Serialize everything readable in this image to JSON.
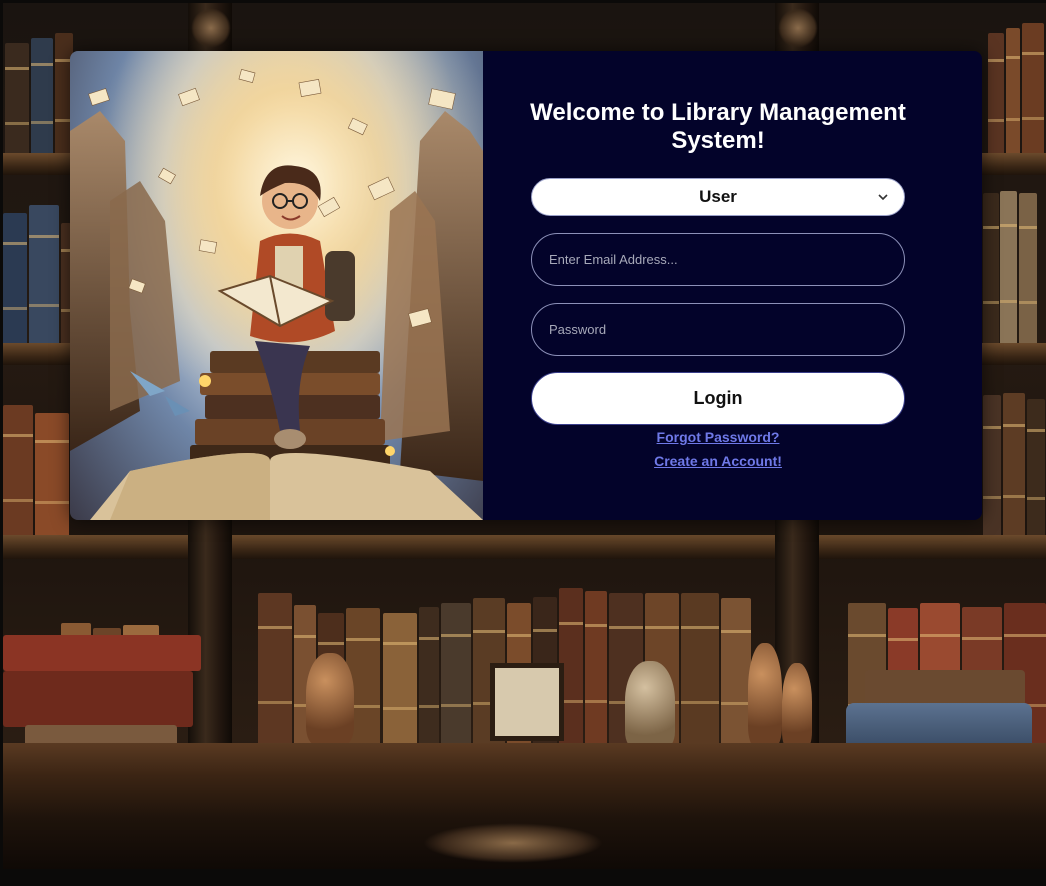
{
  "login_card": {
    "title": "Welcome to Library Management System!",
    "role_select": {
      "selected": "User",
      "icon": "chevron-down-icon"
    },
    "email_field": {
      "placeholder": "Enter Email Address..."
    },
    "password_field": {
      "placeholder": "Password"
    },
    "login_button": "Login",
    "forgot_password_link": "Forgot Password?",
    "create_account_link": "Create an Account!"
  },
  "colors": {
    "panel_bg": "#03032a",
    "link": "#6f79e8",
    "button_bg": "#ffffff"
  }
}
